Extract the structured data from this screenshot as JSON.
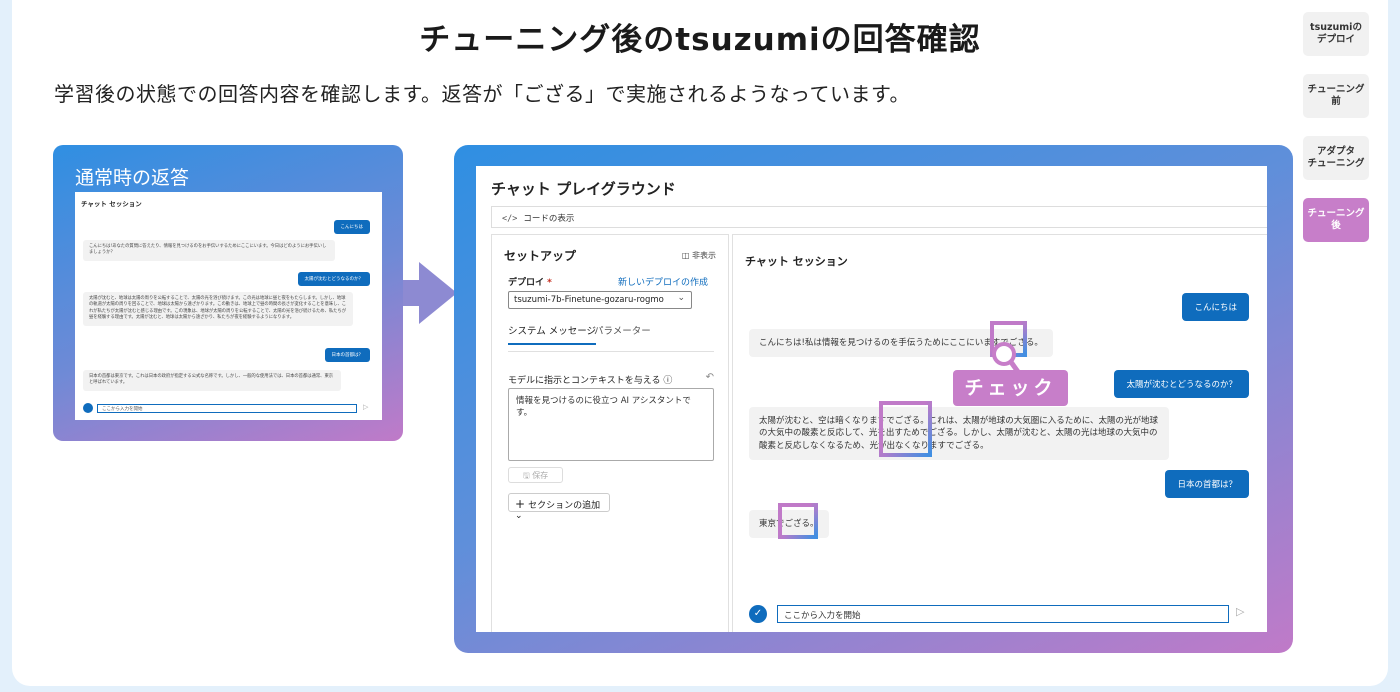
{
  "title": "チューニング後のtsuzumiの回答確認",
  "subtitle": "学習後の状態での回答内容を確認します。返答が「ござる」で実施されるようなっています。",
  "nav": {
    "items": [
      "tsuzumiの\nデプロイ",
      "チューニング\n前",
      "アダプタ\nチューニング",
      "チューニング\n後"
    ]
  },
  "normal_panel": {
    "title": "通常時の返答",
    "session_title": "チャット セッション",
    "msg1_user": "こんにちは",
    "msg1_bot": "こんにちは!あなたの質問に答えたり、情報を見つけるのをお手伝いするためにここにいます。今日はどのようにお手伝いしましょうか？",
    "msg2_user": "太陽が沈むとどうなるのか？",
    "msg2_bot": "太陽が沈むと、地球は太陽の周りを公転することで、太陽の光を浴び続けます。この光は地球に昼と夜をもたらします。しかし、地球の軌道が太陽の周りを回ることで、地球は太陽から遠ざかります。この動きは、地球上で昼の時間の長さが変化することを意味し、これが私たちが太陽が沈むと感じる理由です。この現象は、地球が太陽の周りを公転することで、太陽の光を浴び続けるため、私たちが昼を経験する理由です。太陽が沈むと、地球は太陽から遠ざかり、私たちが夜を経験するようになります。",
    "msg3_user": "日本の首都は？",
    "msg3_bot": "日本の首都は東京です。これは日本の政府が指定する公式な名称です。しかし、一般的な使用法では、日本の首都は通常、東京と呼ばれています。",
    "input_placeholder": "ここから入力を開始"
  },
  "playground": {
    "title": "チャット プレイグラウンド",
    "code_view": "コードの表示",
    "setup": {
      "title": "セットアップ",
      "hide": "非表示",
      "deploy_label": "デプロイ",
      "new_deploy": "新しいデプロイの作成",
      "deploy_value": "tsuzumi-7b-Finetune-gozaru-rogmo",
      "tab_system": "システム メッセージ",
      "tab_params": "パラメーター",
      "sys_label": "モデルに指示とコンテキストを与える",
      "sys_value": "情報を見つけるのに役立つ AI アシスタントです。",
      "save": "保存",
      "add_section": "セクションの追加"
    },
    "chat": {
      "title": "チャット セッション",
      "msg1_user": "こんにちは",
      "msg1_bot": "こんにちは!私は情報を見つけるのを手伝うためにここにいますでござる。",
      "msg2_user": "太陽が沈むとどうなるのか？",
      "msg2_bot": "太陽が沈むと、空は暗くなりますでござる。これは、太陽が地球の大気圏に入るために、太陽の光が地球の大気中の酸素と反応して、光を出すためでござる。しかし、太陽が沈むと、太陽の光は地球の大気中の酸素と反応しなくなるため、光が出なくなりますでござる。",
      "msg3_user": "日本の首都は？",
      "msg3_bot": "東京でござる。",
      "input_placeholder": "ここから入力を開始"
    }
  },
  "check_label": "チェック",
  "colors": {
    "accent": "#0f6cbd",
    "highlight": "#c77ec9"
  }
}
